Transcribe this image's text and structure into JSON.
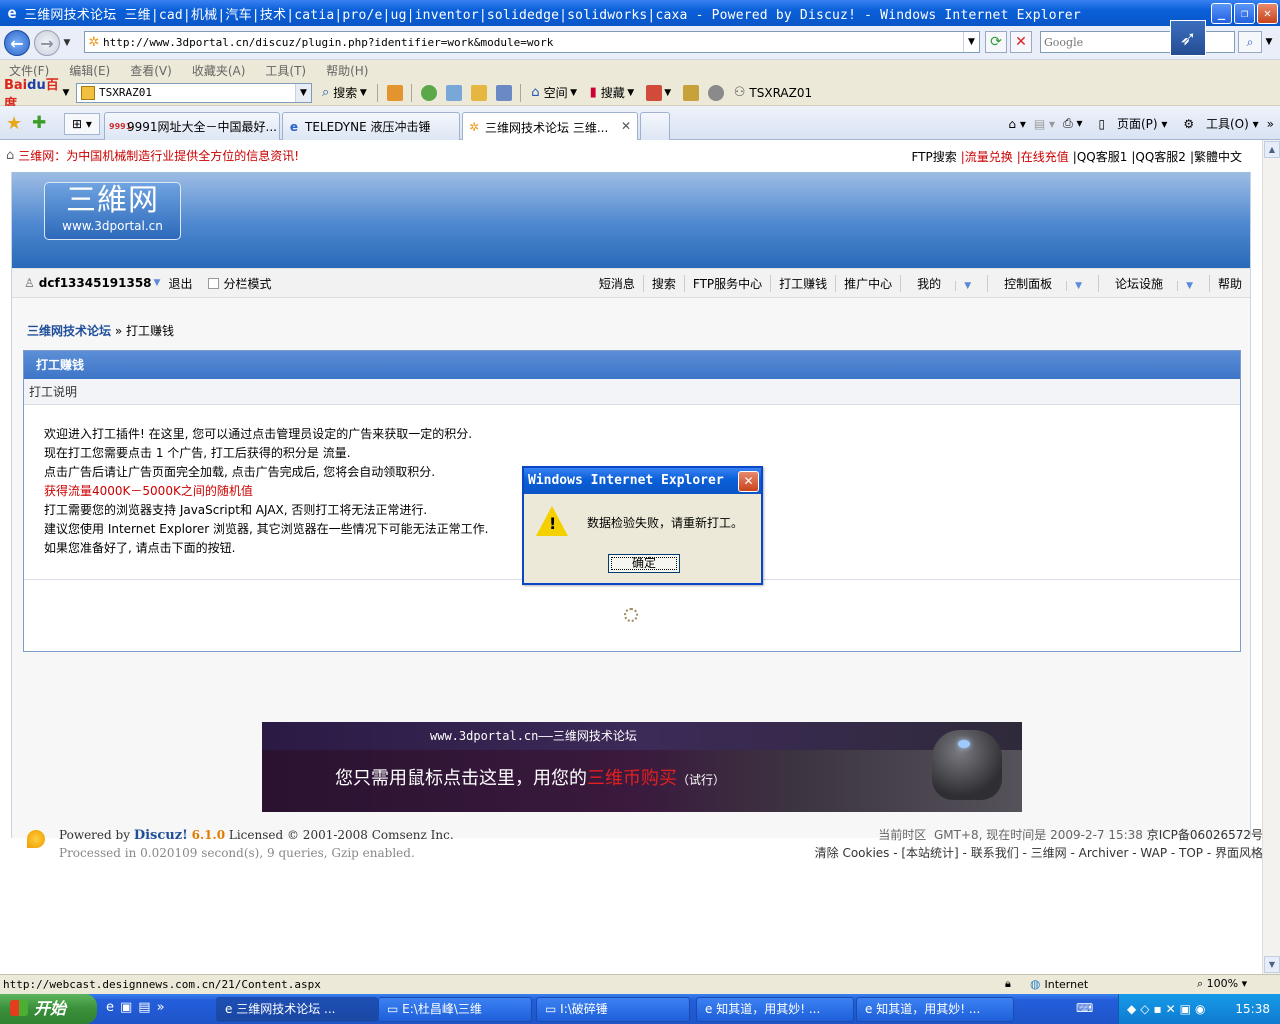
{
  "window": {
    "title": "三维网技术论坛 三维|cad|机械|汽车|技术|catia|pro/e|ug|inventor|solidedge|solidworks|caxa - Powered by Discuz! - Windows Internet Explorer",
    "min": "_",
    "max": "❐",
    "close": "✕"
  },
  "address": {
    "url": "http://www.3dportal.cn/discuz/plugin.php?identifier=work&module=work",
    "search_placeholder": "Google"
  },
  "menu": [
    "文件(F)",
    "编辑(E)",
    "查看(V)",
    "收藏夹(A)",
    "工具(T)",
    "帮助(H)"
  ],
  "toolbar": {
    "logo_a": "Bai",
    "logo_b": "du",
    "logo_c": "百度",
    "combo_value": "TSXRAZ01",
    "search": "搜索",
    "space": "空间",
    "collect": "搜藏",
    "user": "TSXRAZ01"
  },
  "tabs": [
    {
      "label": "9991网址大全－中国最好...",
      "icon": "9991-icon"
    },
    {
      "label": "TELEDYNE 液压冲击锤",
      "icon": "ie-icon"
    },
    {
      "label": "三维网技术论坛 三维...",
      "icon": "sun-icon"
    }
  ],
  "cmdbar": {
    "page": "页面(P)",
    "tools": "工具(O)"
  },
  "notice": {
    "slogan": "三维网：为中国机械制造行业提供全方位的信息资讯!",
    "links": [
      {
        "text": "FTP搜索",
        "red": false
      },
      {
        "text": "|流量兑换",
        "red": true
      },
      {
        "text": "|在线充值",
        "red": true
      },
      {
        "text": "|QQ客服1",
        "red": false
      },
      {
        "text": "|QQ客服2",
        "red": false
      },
      {
        "text": "|繁體中文",
        "red": false
      }
    ]
  },
  "logo": {
    "big": "三維网",
    "small": "www.3dportal.cn"
  },
  "user": {
    "name": "dcf13345191358",
    "logout": "退出",
    "split": "分栏模式"
  },
  "usermenu": [
    "短消息",
    "搜索",
    "FTP服务中心",
    "打工赚钱",
    "推广中心",
    "我的",
    "控制面板",
    "论坛设施",
    "帮助"
  ],
  "breadcrumb": {
    "home": "三维网技术论坛",
    "sep": "»",
    "current": "打工赚钱"
  },
  "box": {
    "title": "打工赚钱",
    "subtitle": "打工说明",
    "lines": [
      "欢迎进入打工插件! 在这里, 您可以通过点击管理员设定的广告来获取一定的积分.",
      "现在打工您需要点击  1 个广告, 打工后获得的积分是  流量.",
      "点击广告后请让广告页面完全加载, 点击广告完成后, 您将会自动领取积分.",
      "获得流量4000K－5000K之间的随机值",
      "打工需要您的浏览器支持  JavaScript和  AJAX, 否则打工将无法正常进行.",
      "建议您使用  Internet Explorer 浏览器, 其它浏览器在一些情况下可能无法正常工作.",
      "如果您准备好了, 请点击下面的按钮."
    ]
  },
  "banner": {
    "top": "www.3dportal.cn——三维网技术论坛",
    "main_a": "您只需用鼠标点击这里，用您的",
    "main_b": "三维币购买",
    "main_c": "（试行）"
  },
  "footer": {
    "powered": "Powered by",
    "discuz": "Discuz!",
    "version": "6.1.0",
    "licensed": "Licensed © 2001-2008 Comsenz Inc.",
    "processed": "Processed in 0.020109 second(s), 9 queries, Gzip enabled.",
    "tz_label": "当前时区",
    "tz_value": "GMT+8, 现在时间是 2009-2-7 15:38",
    "icp": "京ICP备06026572号",
    "links": "清除 Cookies - [本站统计] - 联系我们 - 三维网 - Archiver - WAP - TOP - 界面风格"
  },
  "dialog": {
    "title": "Windows Internet Explorer",
    "message": "数据检验失败，请重新打工。",
    "ok": "确定"
  },
  "status": {
    "url": "http://webcast.designnews.com.cn/21/Content.aspx",
    "zone": "Internet",
    "zoom": "100%"
  },
  "taskbar": {
    "start": "开始",
    "buttons": [
      {
        "label": "三维网技术论坛 ..."
      },
      {
        "label": "E:\\杜昌峰\\三维"
      },
      {
        "label": "I:\\破碎锤"
      },
      {
        "label": "知其道，用其妙! ..."
      },
      {
        "label": "知其道，用其妙! ..."
      }
    ],
    "clock": "15:38"
  }
}
